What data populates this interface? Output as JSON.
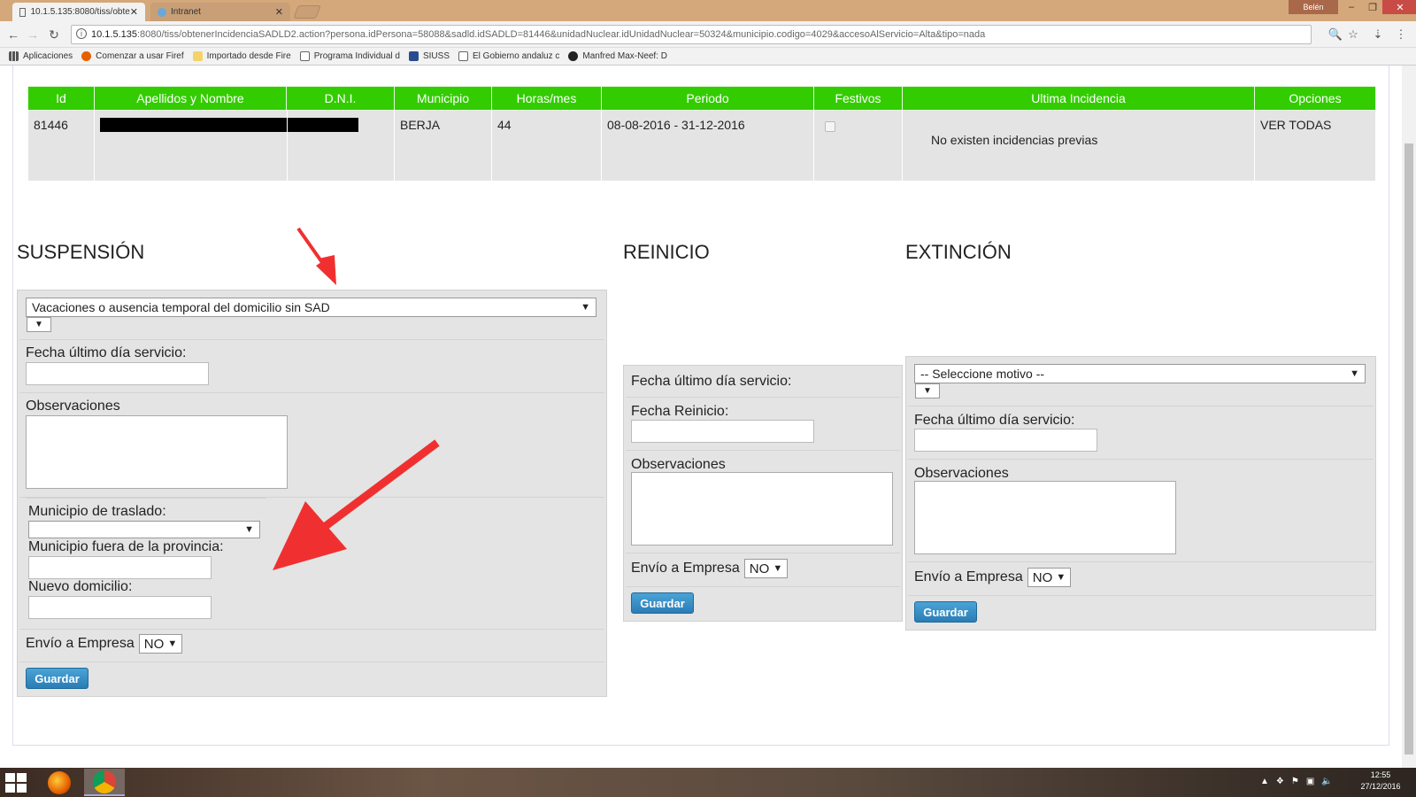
{
  "browser": {
    "tabs": [
      {
        "label": "10.1.5.135:8080/tiss/obte"
      },
      {
        "label": "Intranet"
      }
    ],
    "user": "Belén",
    "url_host": "10.1.5.135",
    "url_rest": ":8080/tiss/obtenerIncidenciaSADLD2.action?persona.idPersona=58088&sadld.idSADLD=81446&unidadNuclear.idUnidadNuclear=50324&municipio.codigo=4029&accesoAlServicio=Alta&tipo=nada",
    "bookmarks": [
      {
        "label": "Aplicaciones",
        "icon": "apps-grid-icon"
      },
      {
        "label": "Comenzar a usar Firef",
        "icon": "firefox-icon"
      },
      {
        "label": "Importado desde Fire",
        "icon": "folder-icon"
      },
      {
        "label": "Programa Individual d",
        "icon": "page-icon"
      },
      {
        "label": "SIUSS",
        "icon": "siuss-icon"
      },
      {
        "label": "El Gobierno andaluz c",
        "icon": "page-icon"
      },
      {
        "label": "Manfred Max-Neef: D",
        "icon": "manfred-icon"
      }
    ]
  },
  "table": {
    "headers": [
      "Id",
      "Apellidos y Nombre",
      "D.N.I.",
      "Municipio",
      "Horas/mes",
      "Periodo",
      "Festivos",
      "Ultima Incidencia",
      "Opciones"
    ],
    "row": {
      "id": "81446",
      "municipio": "BERJA",
      "horas": "44",
      "periodo": "08-08-2016 - 31-12-2016",
      "ultima": "No existen incidencias previas",
      "opciones": "VER TODAS"
    }
  },
  "suspension": {
    "title": "SUSPENSIÓN",
    "motivo": "Vacaciones o ausencia temporal del domicilio sin SAD",
    "fecha_label": "Fecha último día servicio:",
    "obs_label": "Observaciones",
    "municipio_label": "Municipio de traslado:",
    "fuera_label": "Municipio fuera de la provincia:",
    "domicilio_label": "Nuevo domicilio:",
    "envio_label": "Envío a Empresa",
    "envio_value": "NO",
    "guardar": "Guardar"
  },
  "reinicio": {
    "title": "REINICIO",
    "fecha_ultimo_label": "Fecha último día servicio:",
    "fecha_reinicio_label": "Fecha Reinicio:",
    "obs_label": "Observaciones",
    "envio_label": "Envío a Empresa",
    "envio_value": "NO",
    "guardar": "Guardar"
  },
  "extincion": {
    "title": "EXTINCIÓN",
    "motivo": "-- Seleccione motivo --",
    "fecha_label": "Fecha último día servicio:",
    "obs_label": "Observaciones",
    "envio_label": "Envío a Empresa",
    "envio_value": "NO",
    "guardar": "Guardar"
  },
  "taskbar": {
    "time": "12:55",
    "date": "27/12/2016"
  },
  "colors": {
    "header_green": "#33cc00",
    "panel_gray": "#e4e4e4",
    "button_blue": "#2a7db5",
    "annotation_red": "#f03030"
  }
}
